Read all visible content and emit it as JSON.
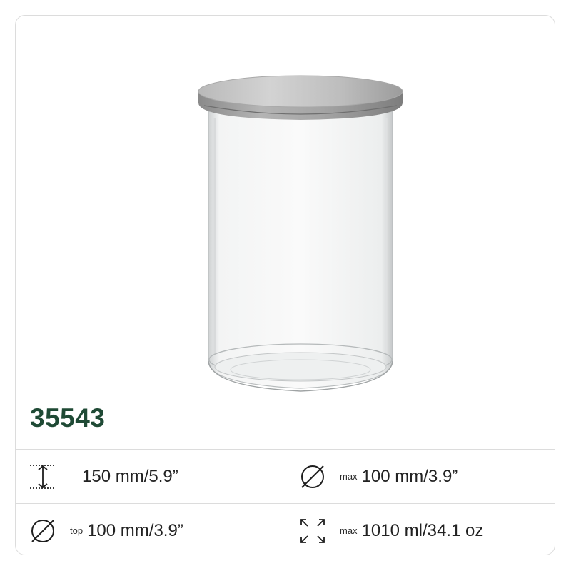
{
  "product": {
    "sku": "35543",
    "image_alt": "Clear glass jar with silver metal lid"
  },
  "specs": [
    {
      "icon": "height-icon",
      "prefix": "",
      "value": "150 mm/5.9”"
    },
    {
      "icon": "diameter-icon",
      "prefix": "max",
      "value": "100 mm/3.9”"
    },
    {
      "icon": "diameter-icon",
      "prefix": "top",
      "value": "100 mm/3.9”"
    },
    {
      "icon": "capacity-icon",
      "prefix": "max",
      "value": "1010 ml/34.1 oz"
    }
  ],
  "colors": {
    "sku_text": "#1f4a35",
    "border": "#dcdcdc",
    "icon_stroke": "#1e1e1e"
  }
}
